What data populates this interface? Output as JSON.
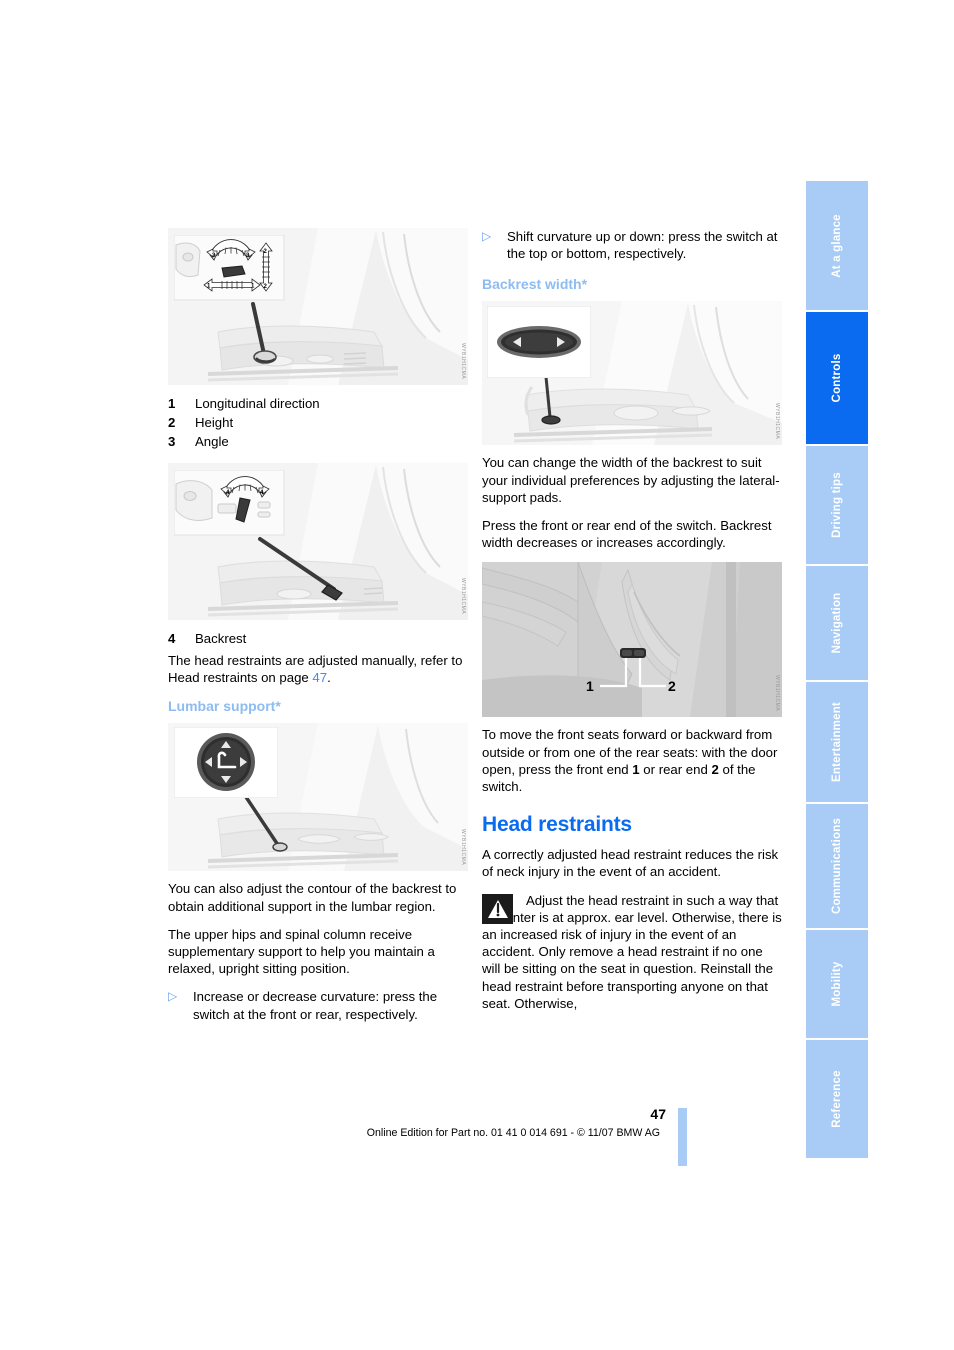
{
  "page": {
    "number": "47",
    "imprint": "Online Edition for Part no. 01 41 0 014 691 - © 11/07 BMW AG"
  },
  "tabs": [
    {
      "label": "At a glance",
      "active": false
    },
    {
      "label": "Controls",
      "active": true
    },
    {
      "label": "Driving tips",
      "active": false
    },
    {
      "label": "Navigation",
      "active": false
    },
    {
      "label": "Entertainment",
      "active": false
    },
    {
      "label": "Communications",
      "active": false
    },
    {
      "label": "Mobility",
      "active": false
    },
    {
      "label": "Reference",
      "active": false
    }
  ],
  "colors": {
    "heading_blue": "#0a6bf0",
    "subheading_blue": "#8cbcf2",
    "tab_inactive": "#a8ccf5",
    "tab_active": "#0a6bf0",
    "link_blue": "#3f8bf5"
  },
  "left_column": {
    "figure_seat_switch": {
      "code": "WYB1H1CMA",
      "arrow_labels": [
        "1",
        "1",
        "2",
        "2",
        "3",
        "3"
      ]
    },
    "legend": [
      {
        "num": "1",
        "text": "Longitudinal direction"
      },
      {
        "num": "2",
        "text": "Height"
      },
      {
        "num": "3",
        "text": "Angle"
      }
    ],
    "figure_backrest": {
      "code": "WYB1H1CMA",
      "arrow_labels": [
        "4",
        "4"
      ]
    },
    "legend2": [
      {
        "num": "4",
        "text": "Backrest"
      }
    ],
    "para_head_restraints": {
      "before": "The head restraints are adjusted manually, refer to Head restraints on page ",
      "link": "47",
      "after": "."
    },
    "heading_lumbar": "Lumbar support*",
    "figure_lumbar": {
      "code": "WYB1H1CMA"
    },
    "para_lumbar_1": "You can also adjust the contour of the backrest to obtain additional support in the lumbar region.",
    "para_lumbar_2": "The upper hips and spinal column receive supplementary support to help you maintain a relaxed, upright sitting position.",
    "bullet_lumbar": "Increase or decrease curvature: press the switch at the front or rear, respectively."
  },
  "right_column": {
    "bullet_shift": "Shift curvature up or down: press the switch at the top or bottom, respectively.",
    "heading_backrest_width": "Backrest width*",
    "figure_backrest_width": {
      "code": "WYB1H1CMA"
    },
    "para_width_1": "You can change the width of the backrest to suit your individual preferences by adjusting the lateral-support pads.",
    "para_width_2": "Press the front or rear end of the switch. Backrest width decreases or increases accordingly.",
    "figure_rear_switch": {
      "code": "WYB1H1CMA",
      "labels": [
        "1",
        "2"
      ]
    },
    "para_move_seats": {
      "t1": "To move the front seats forward or backward from outside or from one of the rear seats: with the door open, press the front end ",
      "b1": "1",
      "t2": " or rear end ",
      "b2": "2",
      "t3": " of the switch."
    },
    "heading_head_restraints": "Head restraints",
    "para_head_1": "A correctly adjusted head restraint reduces the risk of neck injury in the event of an accident.",
    "warning": {
      "icon": "warning-triangle-icon",
      "text": "Adjust the head restraint in such a way that its center is at approx. ear level. Otherwise, there is an increased risk of injury in the event of an accident. Only remove a head restraint if no one will be sitting on the seat in question. Reinstall the head restraint before transporting anyone on that seat. Otherwise,"
    }
  }
}
